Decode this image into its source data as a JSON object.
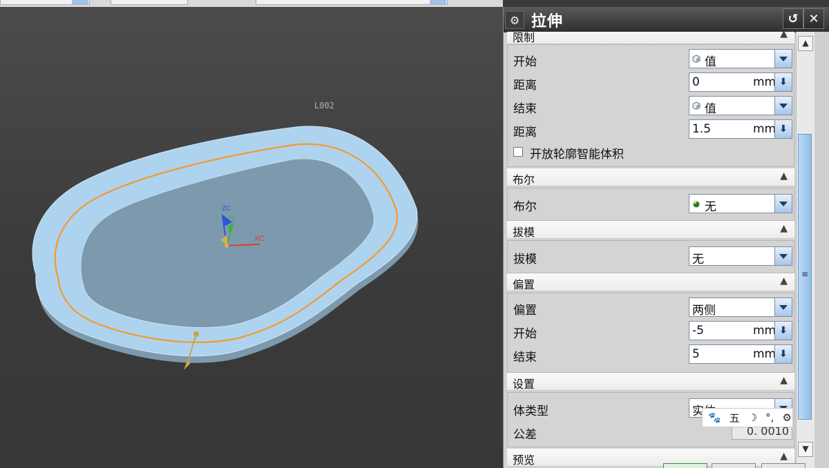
{
  "viewport": {
    "sketch_label": "L002",
    "axis_x": "XC",
    "axis_y": "YC",
    "axis_z": "ZC"
  },
  "dialog": {
    "title": "拉伸",
    "reset_icon": "reset-icon",
    "close_icon": "close-icon",
    "gear_icon": "gear-icon"
  },
  "sections": {
    "limits": {
      "label": "限制",
      "start_label": "开始",
      "start_value": "值",
      "start_distance_label": "距离",
      "start_distance": "0",
      "start_unit": "mm",
      "end_label": "结束",
      "end_value": "值",
      "end_distance_label": "距离",
      "end_distance": "1.5",
      "end_unit": "mm",
      "open_profile_label": "开放轮廓智能体积"
    },
    "boolean": {
      "label": "布尔",
      "field_label": "布尔",
      "value": "无"
    },
    "draft": {
      "label": "拔模",
      "field_label": "拔模",
      "value": "无"
    },
    "offset": {
      "label": "偏置",
      "field_label": "偏置",
      "value": "两侧",
      "start_label": "开始",
      "start_value": "-5",
      "start_unit": "mm",
      "end_label": "结束",
      "end_value": "5",
      "end_unit": "mm"
    },
    "settings": {
      "label": "设置",
      "body_type_label": "体类型",
      "body_type": "实体",
      "tolerance_label": "公差",
      "tolerance": "0. 0010"
    },
    "preview": {
      "label": "预览"
    }
  },
  "ime_bar": {
    "mode": "五"
  },
  "colors": {
    "ring_fill": "#aed3ee",
    "ring_side": "#7d99ad",
    "center_curve": "#f5992f",
    "title_bar": "#3b3b3b",
    "scroll_thumb": "#9fc7ee"
  }
}
